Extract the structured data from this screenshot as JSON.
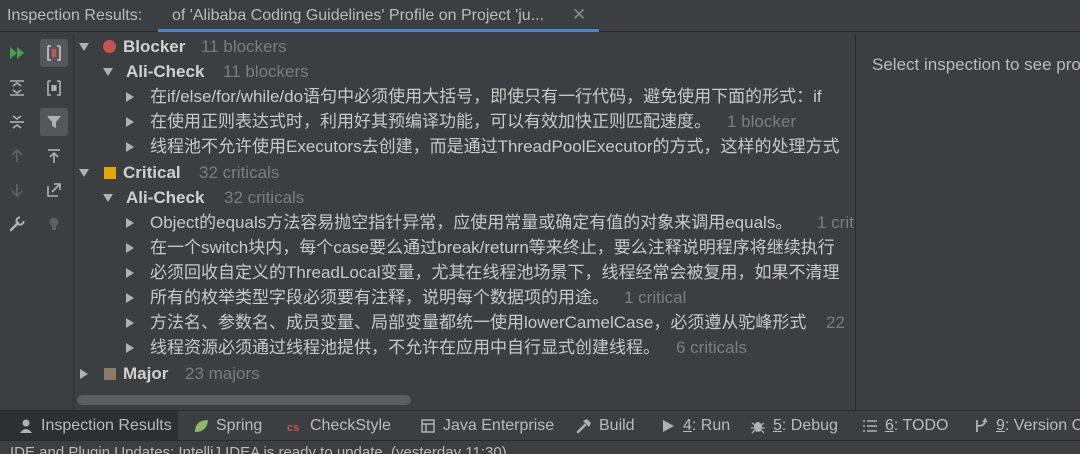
{
  "header": {
    "title": "Inspection Results:",
    "tab_label": "of 'Alibaba Coding Guidelines' Profile on Project 'ju...",
    "tab_close": "✕"
  },
  "toolbar": {
    "icons": [
      "rerun-icon",
      "group-by-severity-icon",
      "expand-all-icon",
      "group-by-directory-icon",
      "collapse-all-icon",
      "filter-icon",
      "previous-icon",
      "export-icon",
      "next-icon",
      "open-in-editor-icon",
      "settings-icon",
      "quick-fix-icon"
    ]
  },
  "tree": {
    "blocker": {
      "label": "Blocker",
      "count": "11 blockers",
      "color": "#c75450"
    },
    "blocker_group": {
      "label": "Ali-Check",
      "count": "11 blockers"
    },
    "blocker_items": [
      {
        "text": "在if/else/for/while/do语句中必须使用大括号，即使只有一行代码，避免使用下面的形式：if",
        "count": ""
      },
      {
        "text": "在使用正则表达式时，利用好其预编译功能，可以有效加快正则匹配速度。",
        "count": "1 blocker"
      },
      {
        "text": "线程池不允许使用Executors去创建，而是通过ThreadPoolExecutor的方式，这样的处理方式",
        "count": ""
      }
    ],
    "critical": {
      "label": "Critical",
      "count": "32 criticals",
      "color": "#e2a50a"
    },
    "critical_group": {
      "label": "Ali-Check",
      "count": "32 criticals"
    },
    "critical_items": [
      {
        "text": "Object的equals方法容易抛空指针异常，应使用常量或确定有值的对象来调用equals。",
        "count": "1 crit"
      },
      {
        "text": "在一个switch块内，每个case要么通过break/return等来终止，要么注释说明程序将继续执行",
        "count": ""
      },
      {
        "text": "必须回收自定义的ThreadLocal变量，尤其在线程池场景下，线程经常会被复用，如果不清理",
        "count": ""
      },
      {
        "text": "所有的枚举类型字段必须要有注释，说明每个数据项的用途。",
        "count": "1 critical"
      },
      {
        "text": "方法名、参数名、成员变量、局部变量都统一使用lowerCamelCase，必须遵从驼峰形式",
        "count": "22"
      },
      {
        "text": "线程资源必须通过线程池提供，不允许在应用中自行显式创建线程。",
        "count": "6 criticals"
      }
    ],
    "major": {
      "label": "Major",
      "count": "23 majors",
      "color": "#8c7b66"
    }
  },
  "detail": {
    "text": "Select inspection to see problems here."
  },
  "bottom_tabs": [
    {
      "label": "Inspection Results",
      "mnemonic": "",
      "icon": "inspection-icon"
    },
    {
      "label": "Spring",
      "mnemonic": "",
      "icon": "spring-icon"
    },
    {
      "label": "CheckStyle",
      "mnemonic": "",
      "icon": "checkstyle-icon"
    },
    {
      "label": "Java Enterprise",
      "mnemonic": "",
      "icon": "java-enterprise-icon"
    },
    {
      "label": "Build",
      "mnemonic": "",
      "icon": "build-icon"
    },
    {
      "label": ": Run",
      "mnemonic": "4",
      "icon": "run-icon"
    },
    {
      "label": ": Debug",
      "mnemonic": "5",
      "icon": "debug-icon"
    },
    {
      "label": ": TODO",
      "mnemonic": "6",
      "icon": "todo-icon"
    },
    {
      "label": ": Version Control",
      "mnemonic": "9",
      "icon": "version-control-icon"
    }
  ],
  "status": {
    "text": "IDE and Plugin Updates: IntelliJ IDEA is ready to update. (yesterday 11:30)"
  },
  "colors": {
    "background": "#3c3f41",
    "accent": "#4a88c7",
    "run_green": "#499c54"
  }
}
